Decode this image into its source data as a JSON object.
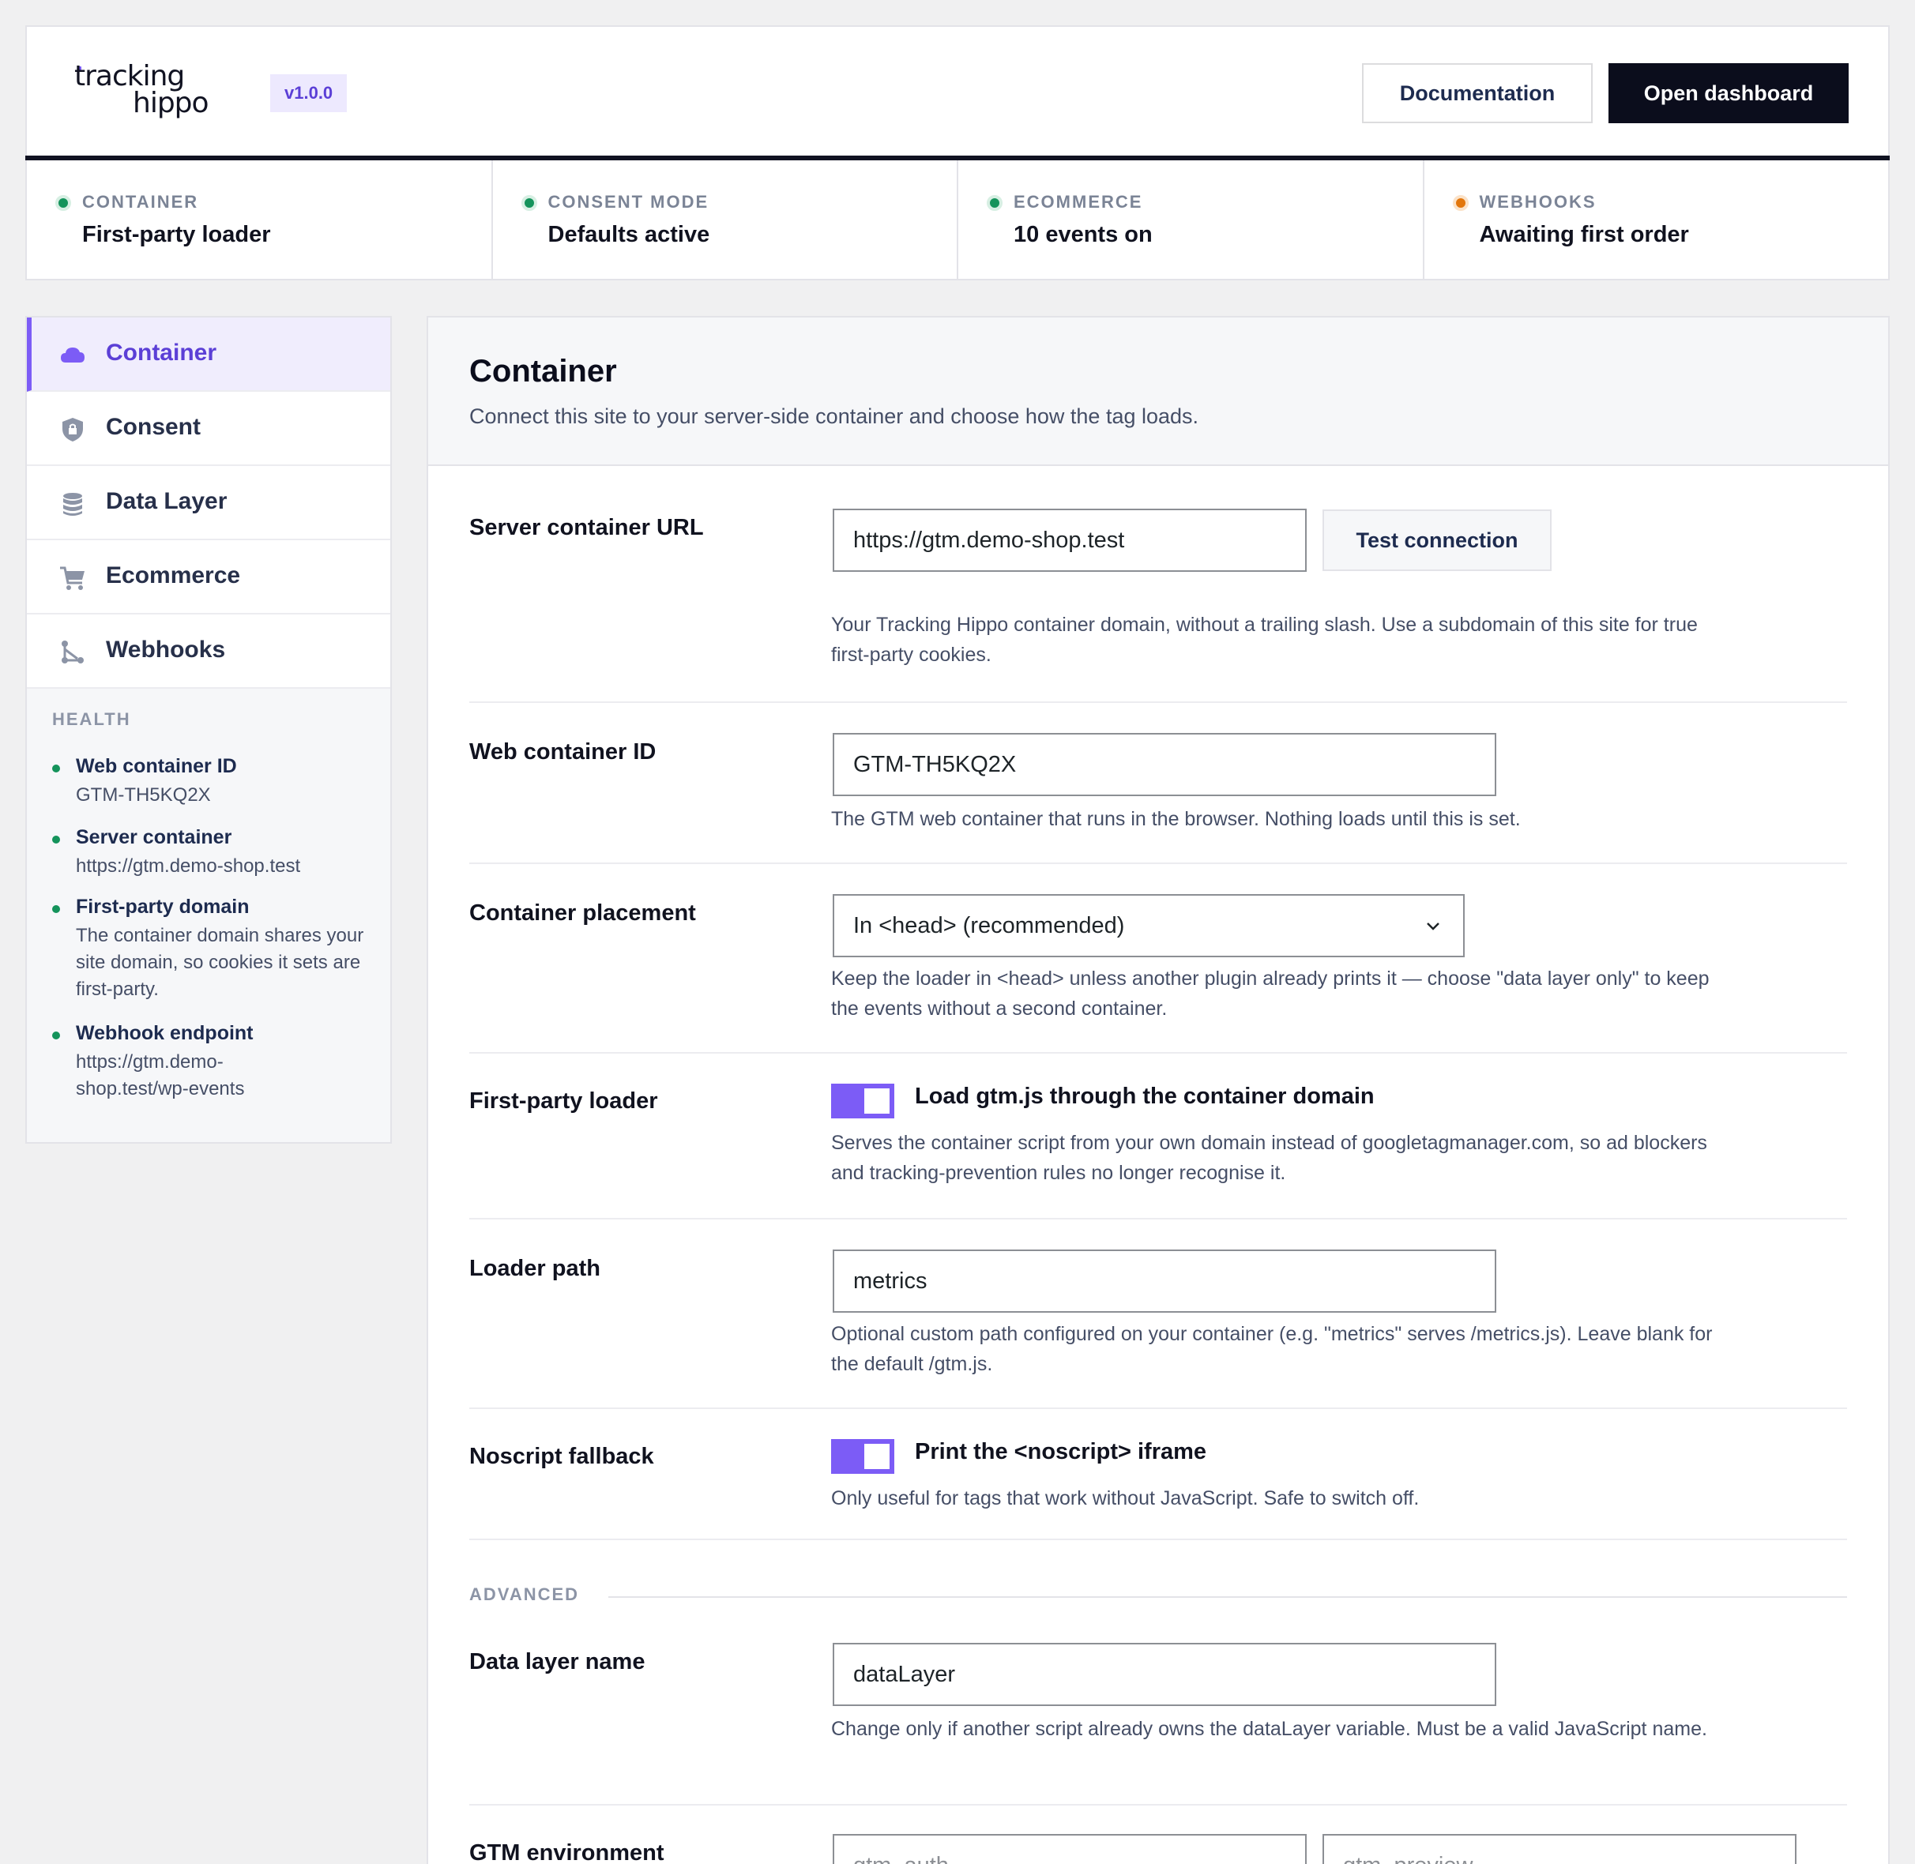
{
  "header": {
    "logo_line1": "tracking",
    "logo_line2": "hippo",
    "version": "v1.0.0",
    "documentation_label": "Documentation",
    "open_dashboard_label": "Open dashboard"
  },
  "status": [
    {
      "label": "CONTAINER",
      "value": "First-party loader",
      "state": "ok"
    },
    {
      "label": "CONSENT MODE",
      "value": "Defaults active",
      "state": "ok"
    },
    {
      "label": "ECOMMERCE",
      "value": "10 events on",
      "state": "ok"
    },
    {
      "label": "WEBHOOKS",
      "value": "Awaiting first order",
      "state": "warn"
    }
  ],
  "colors": {
    "accent": "#7c5cf6",
    "ok": "#14935b",
    "warn": "#e2760c",
    "dark": "#0b0d1c"
  },
  "sidebar": {
    "items": [
      {
        "label": "Container",
        "icon": "cloud-icon",
        "active": true
      },
      {
        "label": "Consent",
        "icon": "shield-lock-icon",
        "active": false
      },
      {
        "label": "Data Layer",
        "icon": "database-icon",
        "active": false
      },
      {
        "label": "Ecommerce",
        "icon": "cart-icon",
        "active": false
      },
      {
        "label": "Webhooks",
        "icon": "webhook-icon",
        "active": false
      }
    ],
    "health_title": "HEALTH",
    "health": [
      {
        "name": "Web container ID",
        "value": "GTM-TH5KQ2X"
      },
      {
        "name": "Server container",
        "value": "https://gtm.demo-shop.test"
      },
      {
        "name": "First-party domain",
        "value": "The container domain shares your site domain, so cookies it sets are first-party."
      },
      {
        "name": "Webhook endpoint",
        "value": "https://gtm.demo-shop.test/wp-events"
      }
    ]
  },
  "main": {
    "title": "Container",
    "subtitle": "Connect this site to your server-side container and choose how the tag loads.",
    "server_url": {
      "label": "Server container URL",
      "value": "https://gtm.demo-shop.test",
      "button": "Test connection",
      "help": "Your Tracking Hippo container domain, without a trailing slash. Use a subdomain of this site for true first-party cookies."
    },
    "web_id": {
      "label": "Web container ID",
      "value": "GTM-TH5KQ2X",
      "help": "The GTM web container that runs in the browser. Nothing loads until this is set."
    },
    "placement": {
      "label": "Container placement",
      "value": "In <head> (recommended)",
      "help": "Keep the loader in <head> unless another plugin already prints it — choose \"data layer only\" to keep the events without a second container."
    },
    "first_party": {
      "label": "First-party loader",
      "toggle_label": "Load gtm.js through the container domain",
      "enabled": true,
      "help": "Serves the container script from your own domain instead of googletagmanager.com, so ad blockers and tracking-prevention rules no longer recognise it."
    },
    "loader_path": {
      "label": "Loader path",
      "value": "metrics",
      "help": "Optional custom path configured on your container (e.g. \"metrics\" serves /metrics.js). Leave blank for the default /gtm.js."
    },
    "noscript": {
      "label": "Noscript fallback",
      "toggle_label": "Print the <noscript> iframe",
      "enabled": true,
      "help": "Only useful for tags that work without JavaScript. Safe to switch off."
    },
    "advanced_title": "ADVANCED",
    "datalayer": {
      "label": "Data layer name",
      "value": "dataLayer",
      "help": "Change only if another script already owns the dataLayer variable. Must be a valid JavaScript name."
    },
    "environment": {
      "label": "GTM environment",
      "auth_placeholder": "gtm_auth",
      "preview_placeholder": "gtm_preview"
    }
  }
}
